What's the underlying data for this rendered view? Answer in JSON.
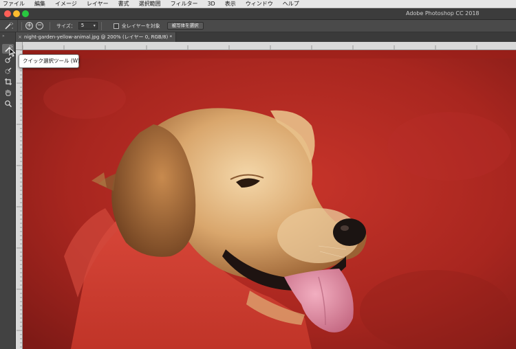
{
  "menubar": {
    "items": [
      "ファイル",
      "編集",
      "イメージ",
      "レイヤー",
      "書式",
      "選択範囲",
      "フィルター",
      "3D",
      "表示",
      "ウィンドウ",
      "ヘルプ"
    ]
  },
  "window": {
    "title": "Adobe Photoshop CC 2018"
  },
  "options_bar": {
    "size_label": "サイズ：",
    "size_value": "5",
    "sample_all_layers_label": "全レイヤーを対象",
    "sample_all_layers_checked": false,
    "select_subject_label": "被写体を選択"
  },
  "document": {
    "tab_title": "night-garden-yellow-animal.jpg @ 200% (レイヤー 0, RGB/8) *"
  },
  "toolbar": {
    "tools": [
      {
        "name": "quick-selection",
        "icon": "quick-selection-brush-icon",
        "selected": true
      },
      {
        "name": "selection-brush",
        "icon": "selection-brush-icon",
        "selected": false
      },
      {
        "name": "refine-brush",
        "icon": "refine-brush-icon",
        "selected": false
      },
      {
        "name": "crop",
        "icon": "crop-icon",
        "selected": false
      },
      {
        "name": "hand",
        "icon": "hand-icon",
        "selected": false
      },
      {
        "name": "zoom",
        "icon": "zoom-icon",
        "selected": false
      }
    ]
  },
  "tooltip": {
    "text": "クイック選択ツール (W)"
  },
  "colors": {
    "overlay_red": "#c0281f",
    "menubar_bg": "#e6e6e6",
    "panel_dark": "#424242",
    "options_bg": "#4a4a4a"
  }
}
